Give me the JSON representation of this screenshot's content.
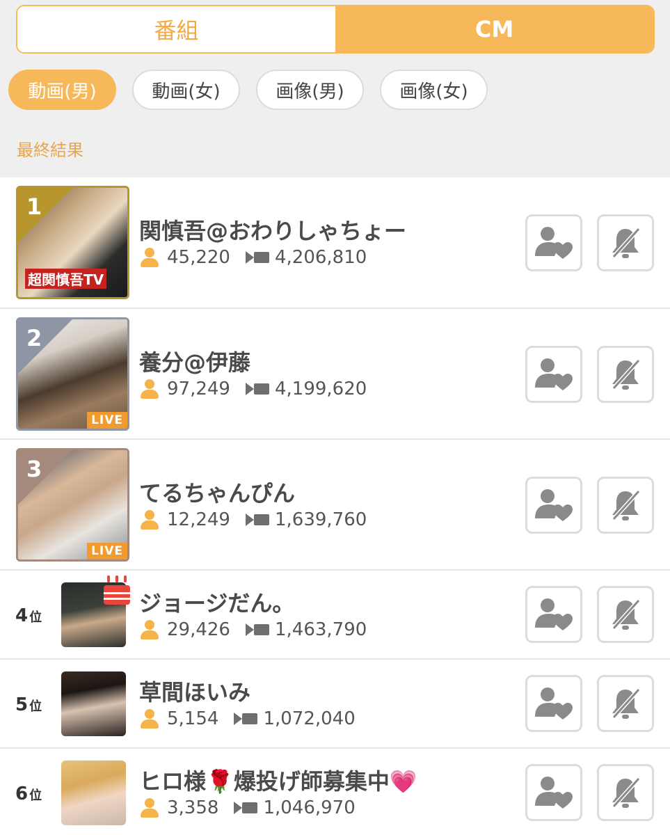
{
  "tabs": [
    {
      "label": "番組",
      "active": false
    },
    {
      "label": "CM",
      "active": true
    }
  ],
  "filters": [
    {
      "label": "動画(男)",
      "active": true
    },
    {
      "label": "動画(女)",
      "active": false
    },
    {
      "label": "画像(男)",
      "active": false
    },
    {
      "label": "画像(女)",
      "active": false
    }
  ],
  "section_label": "最終結果",
  "rank_suffix": "位",
  "live_label": "LIVE",
  "colors": {
    "accent": "#f7b85a",
    "gold": "#b8962e",
    "silver": "#8e96a6",
    "bronze": "#a48a7c",
    "live": "#f29a2e"
  },
  "icons": {
    "viewers": "person-icon",
    "points": "video-camera-icon",
    "follow": "follow-heart-icon",
    "mute": "bell-off-icon"
  },
  "entries": [
    {
      "rank": "1",
      "name": "関慎吾@おわりしゃちょー",
      "viewers": "45,220",
      "points": "4,206,810",
      "live": false,
      "thumb_caption": "超関慎吾TV"
    },
    {
      "rank": "2",
      "name": "養分@伊藤",
      "viewers": "97,249",
      "points": "4,199,620",
      "live": true
    },
    {
      "rank": "3",
      "name": "てるちゃんぴん",
      "viewers": "12,249",
      "points": "1,639,760",
      "live": true
    },
    {
      "rank": "4",
      "name": "ジョージだん。",
      "viewers": "29,426",
      "points": "1,463,790",
      "live": false
    },
    {
      "rank": "5",
      "name": "草間ほいみ",
      "viewers": "5,154",
      "points": "1,072,040",
      "live": false
    },
    {
      "rank": "6",
      "name": "ヒロ様🌹爆投げ師募集中💗",
      "viewers": "3,358",
      "points": "1,046,970",
      "live": false
    }
  ]
}
